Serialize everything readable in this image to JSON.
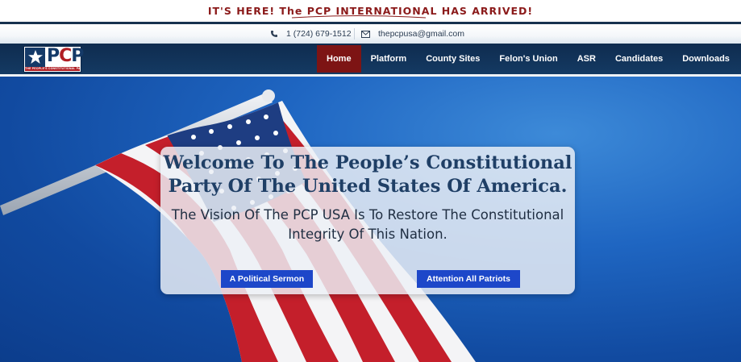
{
  "announcement": {
    "text": "IT'S HERE! The PCP INTERNATIONAL HAS ARRIVED!",
    "color": "#8b1a1a"
  },
  "contact": {
    "phone": "1 (724) 679-1512",
    "email": "thepcpusa@gmail.com",
    "phone_icon": "phone-icon",
    "email_icon": "envelope-icon"
  },
  "logo": {
    "letters_p": "PCP",
    "tagline": "THE PEOPLE'S CONSTITUTIONAL PARTY"
  },
  "nav": {
    "items": [
      {
        "label": "Home",
        "active": true
      },
      {
        "label": "Platform"
      },
      {
        "label": "County Sites"
      },
      {
        "label": "Felon's Union"
      },
      {
        "label": "ASR"
      },
      {
        "label": "Candidates"
      },
      {
        "label": "Downloads"
      }
    ],
    "bar_color": "#143a63",
    "active_color": "#7d1414"
  },
  "hero": {
    "title": "Welcome To The People’s Constitutional Party Of The United States Of America.",
    "subtitle": "The Vision Of The PCP USA Is To Restore The Constitutional Integrity Of This Nation.",
    "buttons": [
      {
        "label": "A Political Sermon"
      },
      {
        "label": "Attention All Patriots"
      }
    ],
    "button_color": "#1d47c9"
  }
}
